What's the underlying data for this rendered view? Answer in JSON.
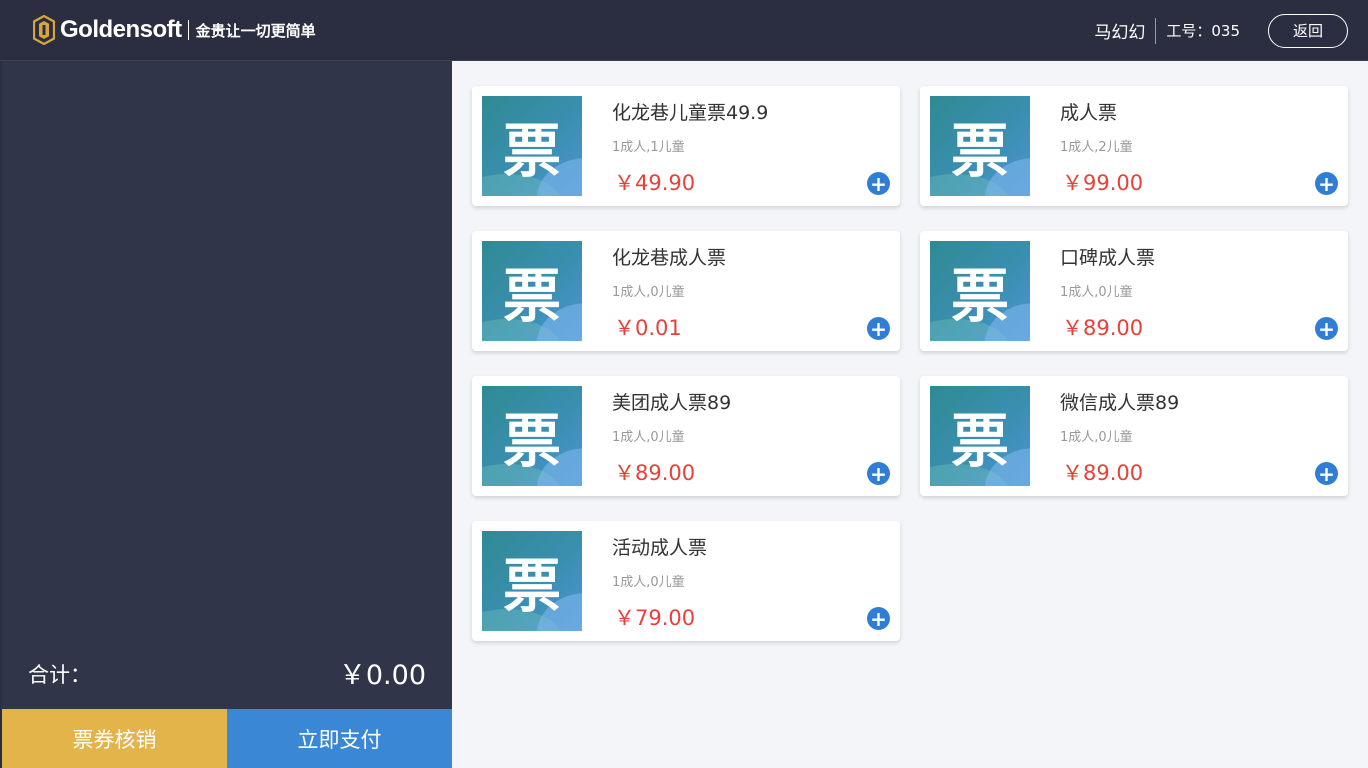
{
  "brand": {
    "name": "Goldensoft",
    "slogan": "金贵让一切更简单"
  },
  "header": {
    "user_name": "马幻幻",
    "employee_id": "工号：035",
    "back_label": "返回"
  },
  "cart": {
    "total_label": "合计：",
    "total_value": "￥0.00",
    "verify_label": "票券核销",
    "pay_label": "立即支付"
  },
  "products": [
    {
      "name": "化龙巷儿童票49.9",
      "desc": "1成人,1儿童",
      "price": "￥49.90",
      "thumb_char": "票"
    },
    {
      "name": "成人票",
      "desc": "1成人,2儿童",
      "price": "￥99.00",
      "thumb_char": "票"
    },
    {
      "name": "化龙巷成人票",
      "desc": "1成人,0儿童",
      "price": "￥0.01",
      "thumb_char": "票"
    },
    {
      "name": "口碑成人票",
      "desc": "1成人,0儿童",
      "price": "￥89.00",
      "thumb_char": "票"
    },
    {
      "name": "美团成人票89",
      "desc": "1成人,0儿童",
      "price": "￥89.00",
      "thumb_char": "票"
    },
    {
      "name": "微信成人票89",
      "desc": "1成人,0儿童",
      "price": "￥89.00",
      "thumb_char": "票"
    },
    {
      "name": "活动成人票",
      "desc": "1成人,0儿童",
      "price": "￥79.00",
      "thumb_char": "票"
    }
  ],
  "icons": {
    "logo": "goldensoft-logo-icon",
    "add": "plus-circle-icon"
  },
  "colors": {
    "header_bg": "#2b2e41",
    "panel_bg": "#30354a",
    "verify_button": "#e2b44a",
    "pay_button": "#3a87d5",
    "price": "#e8413a",
    "add_button": "#2f7ed3",
    "logo_gold": "#d9a63a"
  }
}
